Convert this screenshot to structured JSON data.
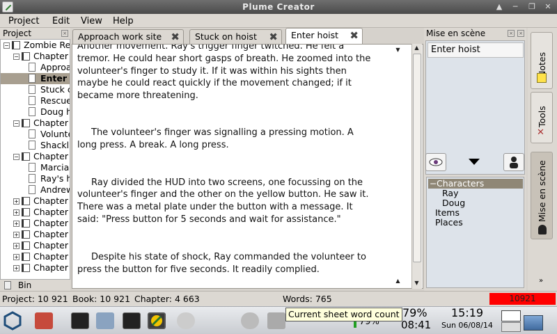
{
  "window": {
    "title": "Plume Creator"
  },
  "menu": [
    "Project",
    "Edit",
    "View",
    "Help"
  ],
  "project_panel": {
    "title": "Project",
    "tree": [
      {
        "label": "Zombie Re",
        "type": "book",
        "indent": 0,
        "expanded": true
      },
      {
        "label": "Chapter",
        "type": "chapter",
        "indent": 1,
        "expanded": true
      },
      {
        "label": "Approa",
        "type": "doc",
        "indent": 2
      },
      {
        "label": "Enter",
        "type": "doc",
        "indent": 2,
        "selected": true
      },
      {
        "label": "Stuck c",
        "type": "doc",
        "indent": 2
      },
      {
        "label": "Rescue",
        "type": "doc",
        "indent": 2
      },
      {
        "label": "Doug h",
        "type": "doc",
        "indent": 2
      },
      {
        "label": "Chapter",
        "type": "chapter",
        "indent": 1,
        "expanded": true
      },
      {
        "label": "Volunte",
        "type": "doc",
        "indent": 2
      },
      {
        "label": "Shackl",
        "type": "doc",
        "indent": 2
      },
      {
        "label": "Chapter",
        "type": "chapter",
        "indent": 1,
        "expanded": true
      },
      {
        "label": "Marcia",
        "type": "doc",
        "indent": 2
      },
      {
        "label": "Ray's h",
        "type": "doc",
        "indent": 2
      },
      {
        "label": "Andrew",
        "type": "doc",
        "indent": 2
      },
      {
        "label": "Chapter",
        "type": "chapter",
        "indent": 1,
        "expanded": false
      },
      {
        "label": "Chapter",
        "type": "chapter",
        "indent": 1,
        "expanded": false
      },
      {
        "label": "Chapter",
        "type": "chapter",
        "indent": 1,
        "expanded": false
      },
      {
        "label": "Chapter",
        "type": "chapter",
        "indent": 1,
        "expanded": false
      },
      {
        "label": "Chapter",
        "type": "chapter",
        "indent": 1,
        "expanded": false
      },
      {
        "label": "Chapter",
        "type": "chapter",
        "indent": 1,
        "expanded": false
      },
      {
        "label": "Chapter",
        "type": "chapter",
        "indent": 1,
        "expanded": false
      }
    ],
    "bin_label": "Bin"
  },
  "tabs": [
    {
      "label": "Approach work site",
      "active": false
    },
    {
      "label": "Stuck on hoist",
      "active": false
    },
    {
      "label": "Enter hoist",
      "active": true
    }
  ],
  "editor": {
    "paragraphs": [
      "Another movement.  Ray's trigger finger twitched.  He felt a tremor.  He could hear short gasps of breath.  He zoomed into the volunteer's finger to study it.  If it was within his sights then maybe he could react quickly if the movement changed; if it became more threatening.",
      "The volunteer's finger was signalling a pressing motion.  A long press.  A break.  A long press.",
      "Ray divided the HUD into two screens, one focussing on the volunteer's finger and the other on the yellow button.  He saw it.  There was a metal plate under the button with a message.  It said: \"Press button for 5 seconds and wait for assistance.\"",
      "Despite his state of shock, Ray commanded the volunteer to press the button for five seconds.  It readily complied."
    ]
  },
  "mise_panel": {
    "title": "Mise en scène",
    "scene_title": "Enter hoist",
    "entities": {
      "characters_label": "Characters",
      "characters": [
        "Ray",
        "Doug"
      ],
      "items_label": "Items",
      "places_label": "Places"
    }
  },
  "side_tabs": [
    "Notes",
    "Tools",
    "Mise en scène"
  ],
  "status": {
    "project": "Project: 10 921",
    "book": "Book: 10 921",
    "chapter": "Chapter: 4 663",
    "words": "Words: 765",
    "counter": "10921"
  },
  "taskbar": {
    "battery": "79%",
    "battery2": "79%",
    "time_small": "08:41",
    "time": "15:19",
    "date": "Sun 06/08/14",
    "tooltip": "Current sheet word count"
  },
  "colors": {
    "selection": "#a89f90",
    "counter_bg": "#ff0000",
    "panel_bg": "#dcd8d2"
  }
}
